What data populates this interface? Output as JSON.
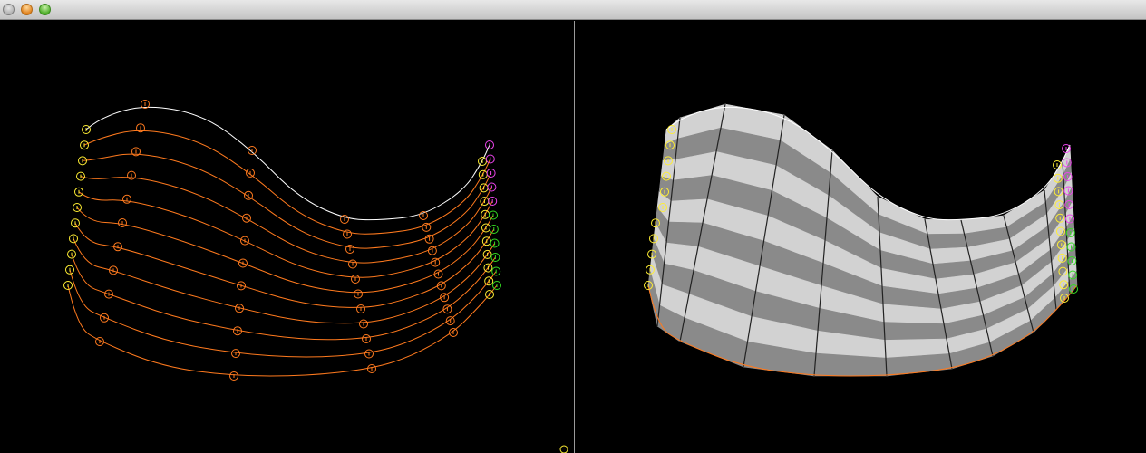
{
  "window": {
    "buttons": {
      "close": "close-button",
      "minimize": "minimize-button",
      "zoom": "zoom-button"
    }
  },
  "colors": {
    "background": "#000000",
    "curve": "#ff7a1e",
    "top_curve": "#ffffff",
    "point_yellow": "#ffee33",
    "point_green": "#33dd22",
    "point_magenta": "#ee44ee",
    "stripe_light": "#d2d2d2",
    "stripe_dark": "#8a8a8a"
  },
  "views": {
    "left": {
      "name": "control-curves-view"
    },
    "right": {
      "name": "surface-view"
    }
  }
}
